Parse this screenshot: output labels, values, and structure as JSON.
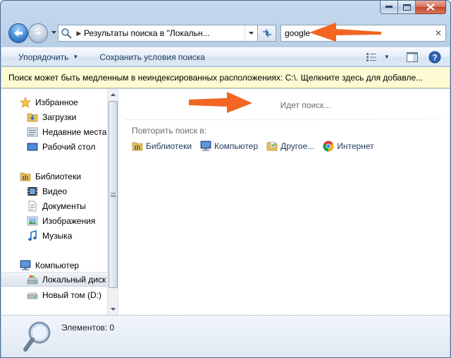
{
  "window": {
    "caption_buttons": [
      "minimize",
      "maximize",
      "close"
    ]
  },
  "navigation": {
    "address_text": "Результаты поиска в \"Локальн...",
    "search_value": "google"
  },
  "toolbar": {
    "organize_label": "Упорядочить",
    "save_search_label": "Сохранить условия поиска"
  },
  "infobar": {
    "message": "Поиск может быть медленным в неиндексированных расположениях: C:\\. Щелкните здесь для добавле..."
  },
  "sidebar": {
    "favorites": {
      "label": "Избранное",
      "items": [
        {
          "label": "Загрузки",
          "icon": "downloads-folder-icon"
        },
        {
          "label": "Недавние места",
          "icon": "recent-places-icon"
        },
        {
          "label": "Рабочий стол",
          "icon": "desktop-icon"
        }
      ]
    },
    "libraries": {
      "label": "Библиотеки",
      "items": [
        {
          "label": "Видео",
          "icon": "video-icon"
        },
        {
          "label": "Документы",
          "icon": "documents-icon"
        },
        {
          "label": "Изображения",
          "icon": "pictures-icon"
        },
        {
          "label": "Музыка",
          "icon": "music-icon"
        }
      ]
    },
    "computer": {
      "label": "Компьютер",
      "items": [
        {
          "label": "Локальный диск",
          "icon": "local-disk-icon",
          "selected": true
        },
        {
          "label": "Новый том (D:)",
          "icon": "drive-icon"
        }
      ]
    }
  },
  "content": {
    "status": "Идет поиск...",
    "search_again_label": "Повторить поиск в:",
    "search_again_items": [
      {
        "label": "Библиотеки",
        "icon": "libraries-icon"
      },
      {
        "label": "Компьютер",
        "icon": "computer-icon"
      },
      {
        "label": "Другое...",
        "icon": "custom-folder-icon"
      },
      {
        "label": "Интернет",
        "icon": "chrome-icon"
      }
    ]
  },
  "details": {
    "count_text": "Элементов: 0"
  },
  "colors": {
    "annotation_arrow": "#f26522",
    "infobar_background": "#fdfbd2"
  }
}
